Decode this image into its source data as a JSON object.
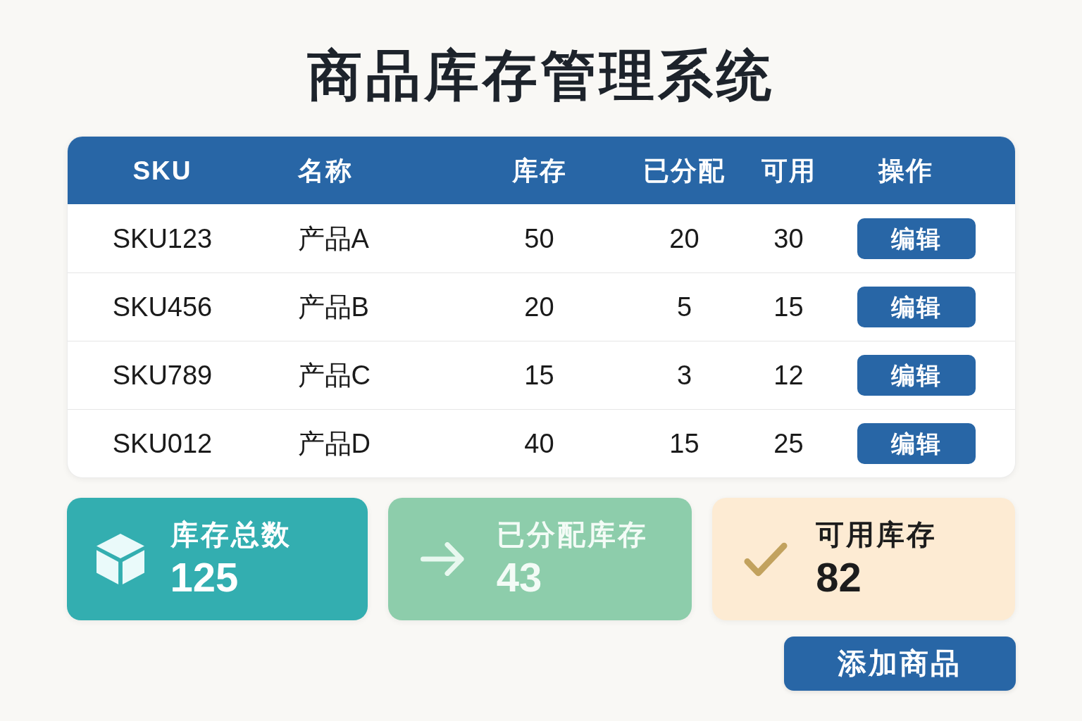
{
  "title": "商品库存管理系统",
  "table": {
    "columns": [
      "SKU",
      "名称",
      "库存",
      "已分配",
      "可用",
      "操作"
    ],
    "rows": [
      {
        "sku": "SKU123",
        "name": "产品A",
        "stock": "50",
        "allocated": "20",
        "available": "30",
        "action": "编辑"
      },
      {
        "sku": "SKU456",
        "name": "产品B",
        "stock": "20",
        "allocated": "5",
        "available": "15",
        "action": "编辑"
      },
      {
        "sku": "SKU789",
        "name": "产品C",
        "stock": "15",
        "allocated": "3",
        "available": "12",
        "action": "编辑"
      },
      {
        "sku": "SKU012",
        "name": "产品D",
        "stock": "40",
        "allocated": "15",
        "available": "25",
        "action": "编辑"
      }
    ]
  },
  "stats": [
    {
      "kind": "box",
      "label": "库存总数",
      "value": "125",
      "color": "#33aeb0"
    },
    {
      "kind": "arrow",
      "label": "已分配库存",
      "value": "43",
      "color": "#8dcdab"
    },
    {
      "kind": "check",
      "label": "可用库存",
      "value": "82",
      "color": "#fdebd3"
    }
  ],
  "add_button": "添加商品"
}
